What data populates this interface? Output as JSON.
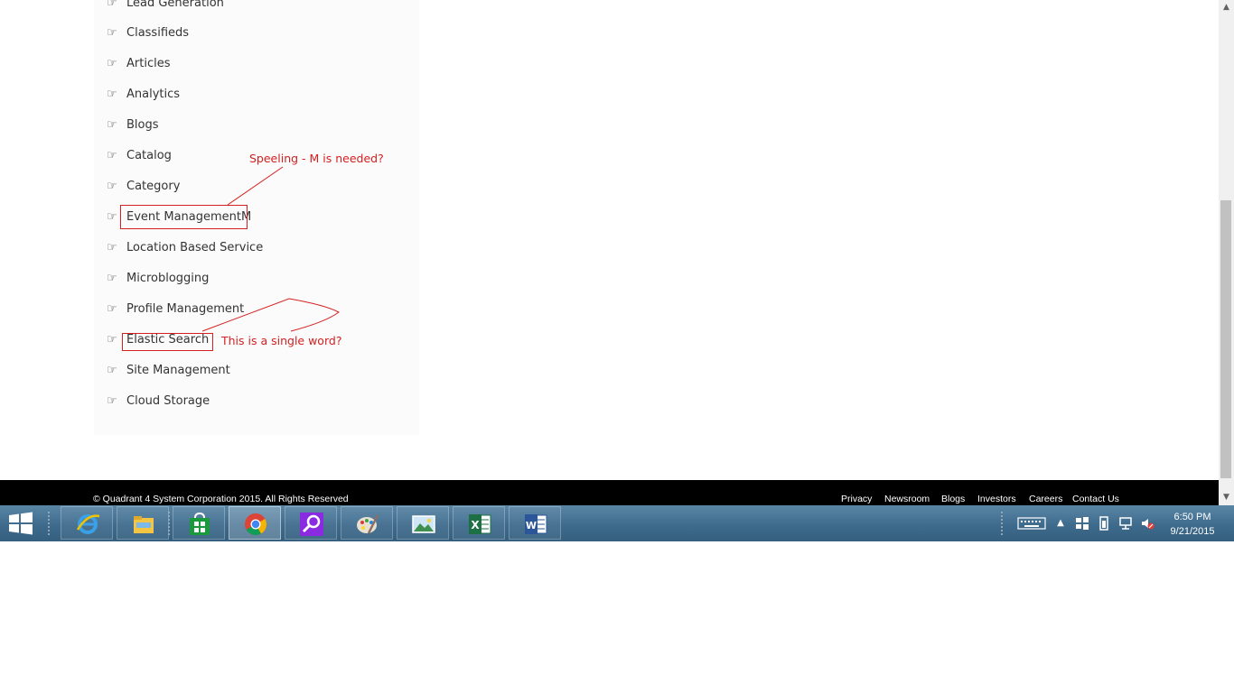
{
  "menu": {
    "items": [
      {
        "label": "Lead Generation"
      },
      {
        "label": "Classifieds"
      },
      {
        "label": "Articles"
      },
      {
        "label": "Analytics"
      },
      {
        "label": "Blogs"
      },
      {
        "label": "Catalog"
      },
      {
        "label": "Category"
      },
      {
        "label": "Event ManagementM"
      },
      {
        "label": "Location Based Service"
      },
      {
        "label": "Microblogging"
      },
      {
        "label": "Profile Management"
      },
      {
        "label": "Elastic Search"
      },
      {
        "label": "Site Management"
      },
      {
        "label": "Cloud Storage"
      }
    ],
    "bullet_icon": "hand-pointing-right-icon"
  },
  "annotations": {
    "spelling_note": "Speeling - M is needed?",
    "single_word_note": "This is  a single word?",
    "color": "#d42020"
  },
  "footer": {
    "copyright": "© Quadrant 4 System Corporation 2015. All Rights Reserved",
    "links": [
      "Privacy",
      "Newsroom",
      "Blogs",
      "Investors",
      "Careers",
      "Contact Us"
    ]
  },
  "taskbar": {
    "apps": [
      {
        "name": "internet-explorer-icon"
      },
      {
        "name": "file-explorer-icon"
      },
      {
        "name": "store-icon"
      },
      {
        "name": "chrome-icon"
      },
      {
        "name": "search-app-icon"
      },
      {
        "name": "paint-icon"
      },
      {
        "name": "photo-viewer-icon"
      },
      {
        "name": "excel-icon"
      },
      {
        "name": "word-icon"
      }
    ],
    "clock": {
      "time": "6:50 PM",
      "date": "9/21/2015"
    }
  }
}
